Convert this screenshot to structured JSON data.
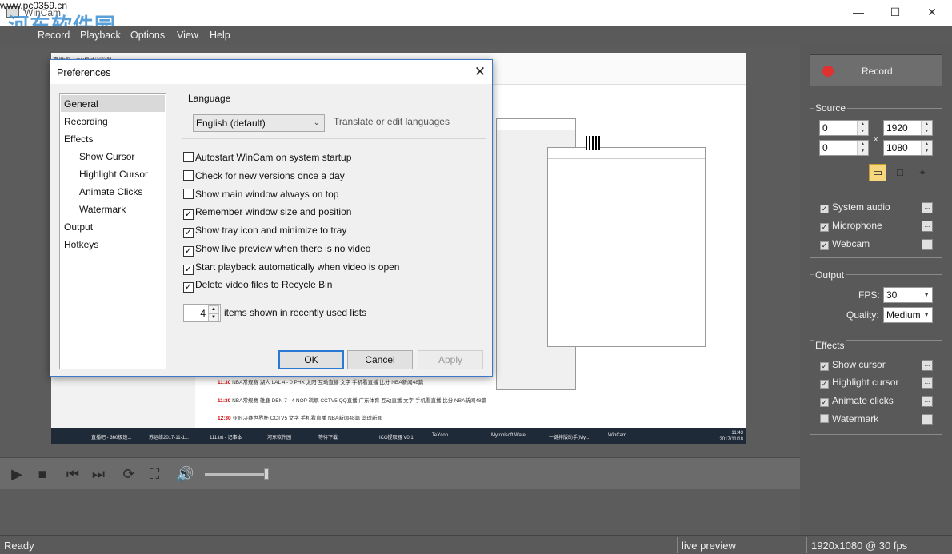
{
  "window": {
    "title": "WinCam",
    "watermark_text": "河东软件园",
    "watermark_url": "www.pc0359.cn"
  },
  "menu": [
    "Record",
    "Playback",
    "Options",
    "View",
    "Help"
  ],
  "dialog": {
    "title": "Preferences",
    "nav": [
      "General",
      "Recording",
      "Effects",
      "Show Cursor",
      "Highlight Cursor",
      "Animate Clicks",
      "Watermark",
      "Output",
      "Hotkeys"
    ],
    "selected_nav": "General",
    "language_group": "Language",
    "language_value": "English (default)",
    "translate_link": "Translate or edit languages",
    "options": [
      {
        "label": "Autostart WinCam on system startup",
        "checked": false
      },
      {
        "label": "Check for new versions once a day",
        "checked": false
      },
      {
        "label": "Show main window always on top",
        "checked": false
      },
      {
        "label": "Remember window size and position",
        "checked": true
      },
      {
        "label": "Show tray icon and minimize to tray",
        "checked": true
      },
      {
        "label": "Show live preview when there is no video",
        "checked": true
      },
      {
        "label": "Start playback automatically when video is open",
        "checked": true
      },
      {
        "label": "Delete video files to Recycle Bin",
        "checked": true
      }
    ],
    "recent_count": "4",
    "recent_label": "items shown in recently used lists",
    "buttons": {
      "ok": "OK",
      "cancel": "Cancel",
      "apply": "Apply"
    }
  },
  "right_panel": {
    "record_label": "Record",
    "source_label": "Source",
    "x": "0",
    "y": "0",
    "width": "1920",
    "height": "1080",
    "by": "x",
    "source_checks": [
      {
        "label": "System audio",
        "checked": true
      },
      {
        "label": "Microphone",
        "checked": true
      },
      {
        "label": "Webcam",
        "checked": true
      }
    ],
    "output_label": "Output",
    "fps_label": "FPS:",
    "fps_value": "30",
    "quality_label": "Quality:",
    "quality_value": "Medium",
    "effects_label": "Effects",
    "effects": [
      {
        "label": "Show cursor",
        "checked": true
      },
      {
        "label": "Highlight cursor",
        "checked": true
      },
      {
        "label": "Animate clicks",
        "checked": true
      },
      {
        "label": "Watermark",
        "checked": false
      }
    ],
    "more": "..."
  },
  "status": {
    "left": "Ready",
    "middle": "live preview",
    "right": "1920x1080 @ 30 fps"
  },
  "preview": {
    "tab": "直播吧 - 360极速浏览器",
    "rows": [
      {
        "time": "11:30",
        "text": "NBA常规赛 湖人 LAL 4 - 0 PHX 太阳 互动直播 文字 手机看直播 比分 NBA新闻48篇"
      },
      {
        "time": "11:30",
        "text": "NBA常规赛 雄鹿 DEN 7 - 4 NOP 鹈鹕 CCTV5 QQ直播 广东体育 互动直播 文字 手机看直播 比分 NBA新闻48篇"
      },
      {
        "time": "12:30",
        "text": "亚冠决赛世界杯 CCTV5 文字 手机看直播 NBA新闻48篇 篮球新闻"
      }
    ],
    "taskbar": [
      "直播吧 - 360极速...",
      "苏运维2017-11-1...",
      "111.txt - 记事本",
      "河东软件园",
      "等待下载",
      "ICO提取器 V0.1",
      "TeYcon",
      "Mytoolsoft Wate...",
      "一键排版助手(My...",
      "WinCam"
    ],
    "clock_time": "11:43",
    "clock_date": "2017/11/18",
    "fps_overlay": "1920x1080 @ 30 fps"
  }
}
